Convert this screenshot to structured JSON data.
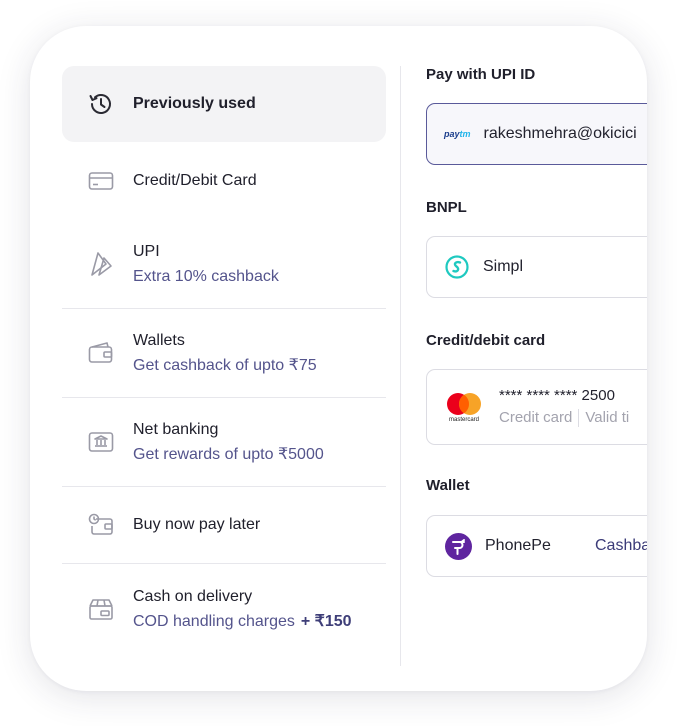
{
  "methods": [
    {
      "label": "Previously used"
    },
    {
      "label": "Credit/Debit Card"
    },
    {
      "label": "UPI",
      "sub": "Extra 10% cashback"
    },
    {
      "label": "Wallets",
      "sub": "Get cashback of upto ₹75"
    },
    {
      "label": "Net banking",
      "sub": "Get rewards of upto ₹5000"
    },
    {
      "label": "Buy now pay later"
    },
    {
      "label": "Cash on delivery",
      "sub": "COD handling charges",
      "extra": "+ ₹150"
    }
  ],
  "upi": {
    "title": "Pay with UPI ID",
    "provider_logo": {
      "part1": "pay",
      "part2": "tm"
    },
    "id_value": "rakeshmehra@okicici"
  },
  "bnpl": {
    "title": "BNPL",
    "provider": "Simpl"
  },
  "card": {
    "title": "Credit/debit card",
    "number": "**** **** **** 2500",
    "type": "Credit card",
    "validity": "Valid ti",
    "brand_logo_text": "mastercard"
  },
  "wallet": {
    "title": "Wallet",
    "provider": "PhonePe",
    "action": "Cashba"
  },
  "colors": {
    "accent": "#3b3b78",
    "selected_border": "#5a5a9a",
    "simpl": "#1fc9c0",
    "phonepe": "#5f259f",
    "mc_red": "#eb001b",
    "mc_orange": "#f79e1b"
  }
}
